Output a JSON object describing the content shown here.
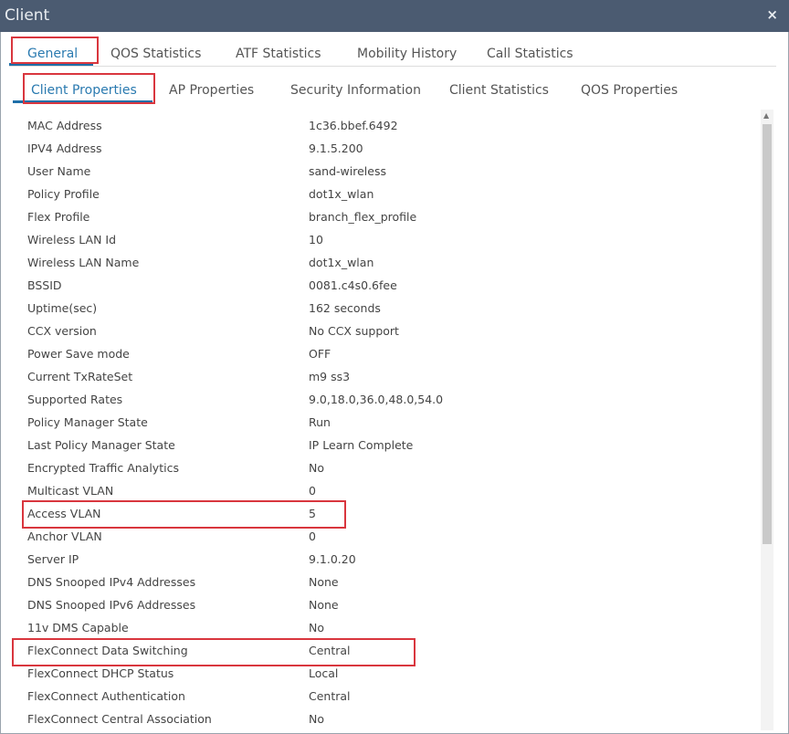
{
  "title": "Client",
  "close": "×",
  "tabs": [
    "General",
    "QOS Statistics",
    "ATF Statistics",
    "Mobility History",
    "Call Statistics"
  ],
  "subtabs": [
    "Client Properties",
    "AP Properties",
    "Security Information",
    "Client Statistics",
    "QOS Properties"
  ],
  "rows": [
    [
      "MAC Address",
      "1c36.bbef.6492"
    ],
    [
      "IPV4 Address",
      "9.1.5.200"
    ],
    [
      "User Name",
      "sand-wireless"
    ],
    [
      "Policy Profile",
      "dot1x_wlan"
    ],
    [
      "Flex Profile",
      "branch_flex_profile"
    ],
    [
      "Wireless LAN Id",
      "10"
    ],
    [
      "Wireless LAN Name",
      "dot1x_wlan"
    ],
    [
      "BSSID",
      "0081.c4s0.6fee"
    ],
    [
      "Uptime(sec)",
      "162 seconds"
    ],
    [
      "CCX version",
      "No CCX support"
    ],
    [
      "Power Save mode",
      "OFF"
    ],
    [
      "Current TxRateSet",
      "m9 ss3"
    ],
    [
      "Supported Rates",
      "9.0,18.0,36.0,48.0,54.0"
    ],
    [
      "Policy Manager State",
      "Run"
    ],
    [
      "Last Policy Manager State",
      "IP Learn Complete"
    ],
    [
      "Encrypted Traffic Analytics",
      "No"
    ],
    [
      "Multicast VLAN",
      "0"
    ],
    [
      "Access VLAN",
      "5"
    ],
    [
      "Anchor VLAN",
      "0"
    ],
    [
      "Server IP",
      "9.1.0.20"
    ],
    [
      "DNS Snooped IPv4 Addresses",
      "None"
    ],
    [
      "DNS Snooped IPv6 Addresses",
      "None"
    ],
    [
      "11v DMS Capable",
      "No"
    ],
    [
      "FlexConnect Data Switching",
      "Central"
    ],
    [
      "FlexConnect DHCP Status",
      "Local"
    ],
    [
      "FlexConnect Authentication",
      "Central"
    ],
    [
      "FlexConnect Central Association",
      "No"
    ]
  ],
  "highlight_color": "#d9363e",
  "accent_color": "#1e6fa8"
}
